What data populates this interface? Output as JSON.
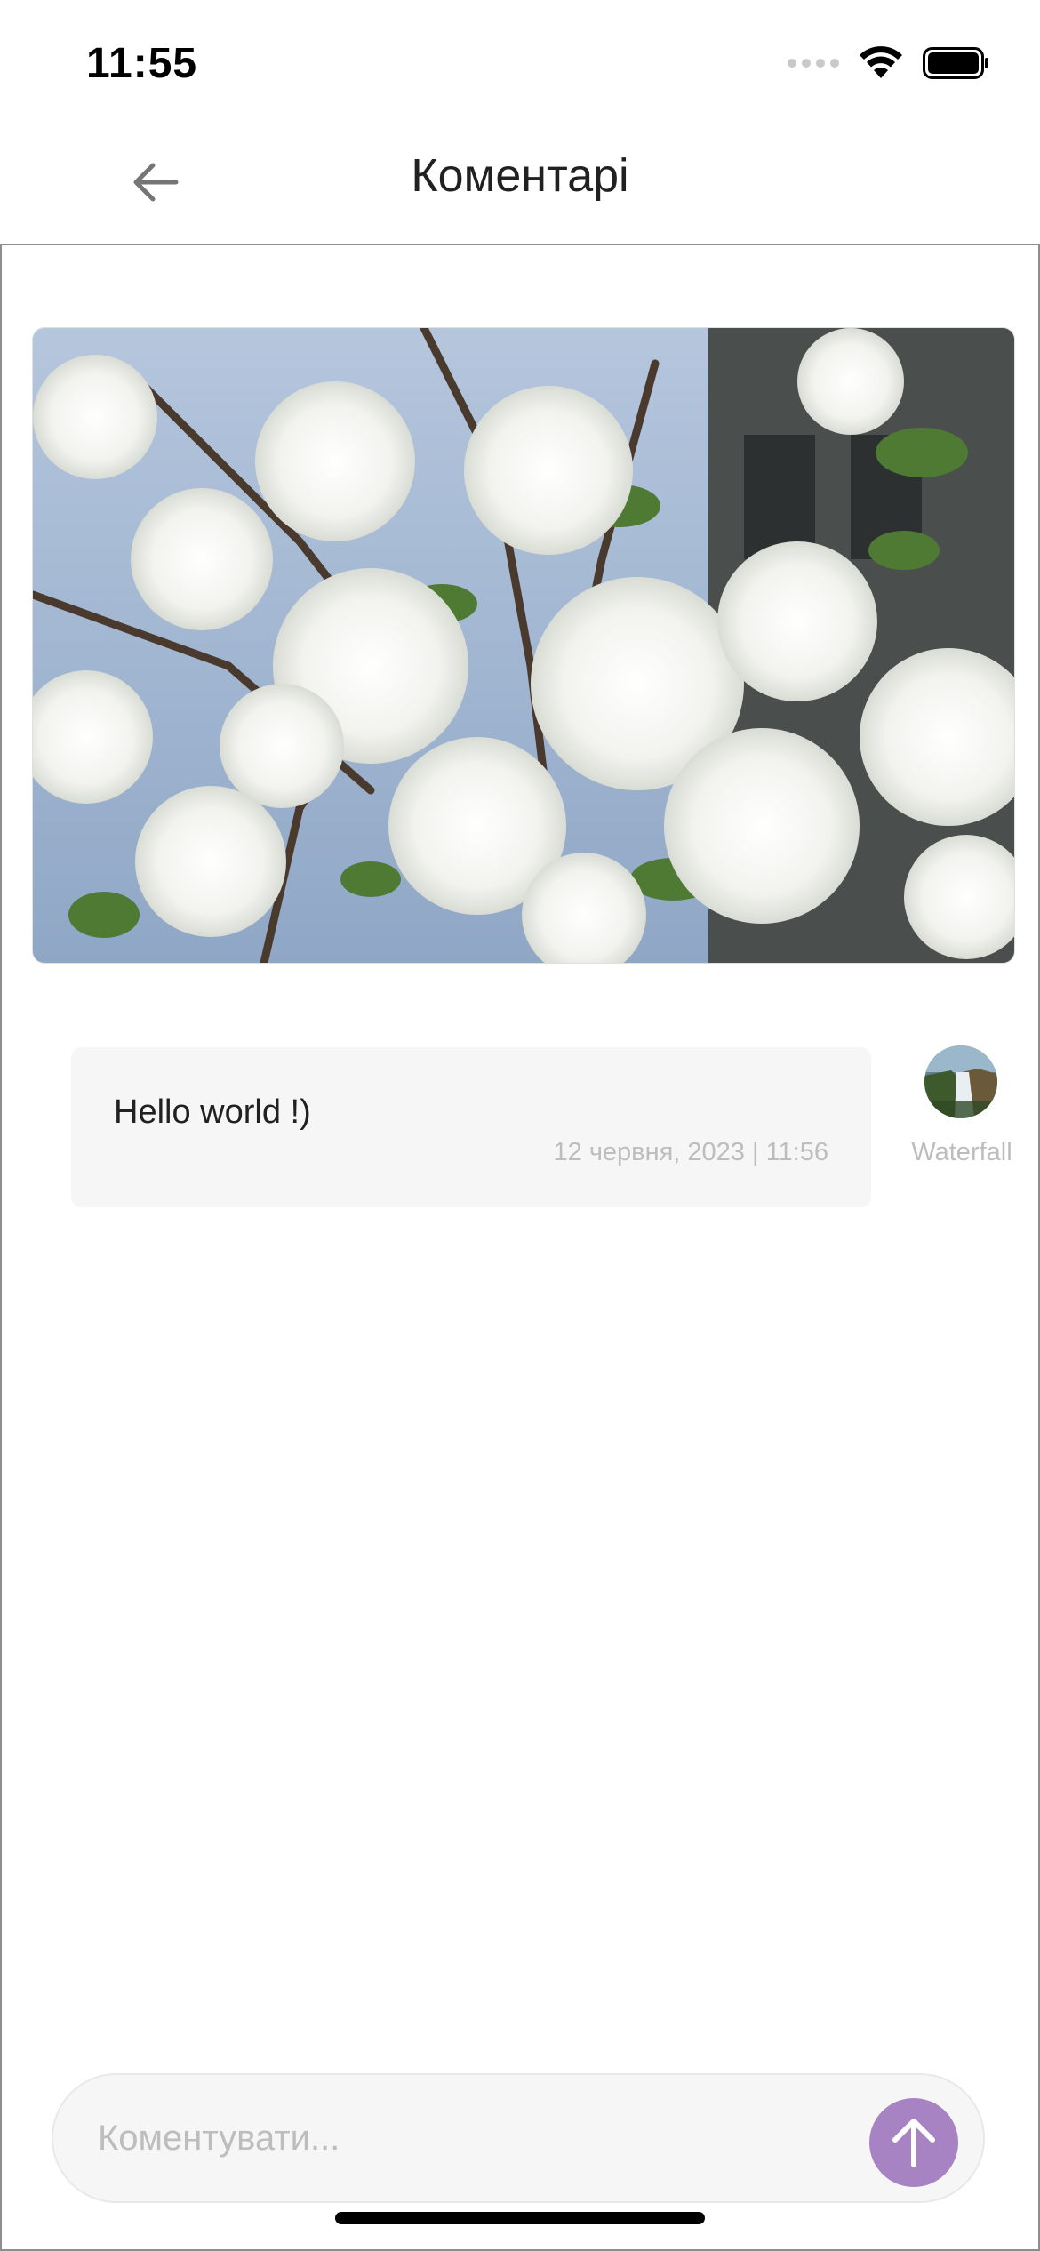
{
  "status_bar": {
    "time": "11:55",
    "icons": [
      "cellular-signal-icon",
      "wifi-icon",
      "battery-icon"
    ]
  },
  "header": {
    "title": "Коментарі",
    "back_icon": "arrow-left-icon"
  },
  "post": {
    "image": "cherry-blossom-photo"
  },
  "comments": [
    {
      "text": "Hello world !)",
      "date": "12 червня, 2023 | 11:56",
      "author": "Waterfall",
      "avatar": "waterfall-avatar"
    }
  ],
  "composer": {
    "placeholder": "Коментувати...",
    "value": "",
    "send_icon": "arrow-up-icon"
  },
  "colors": {
    "accent": "#a883c4",
    "bubble": "#f6f6f6",
    "muted_text": "#bdbdbd"
  }
}
